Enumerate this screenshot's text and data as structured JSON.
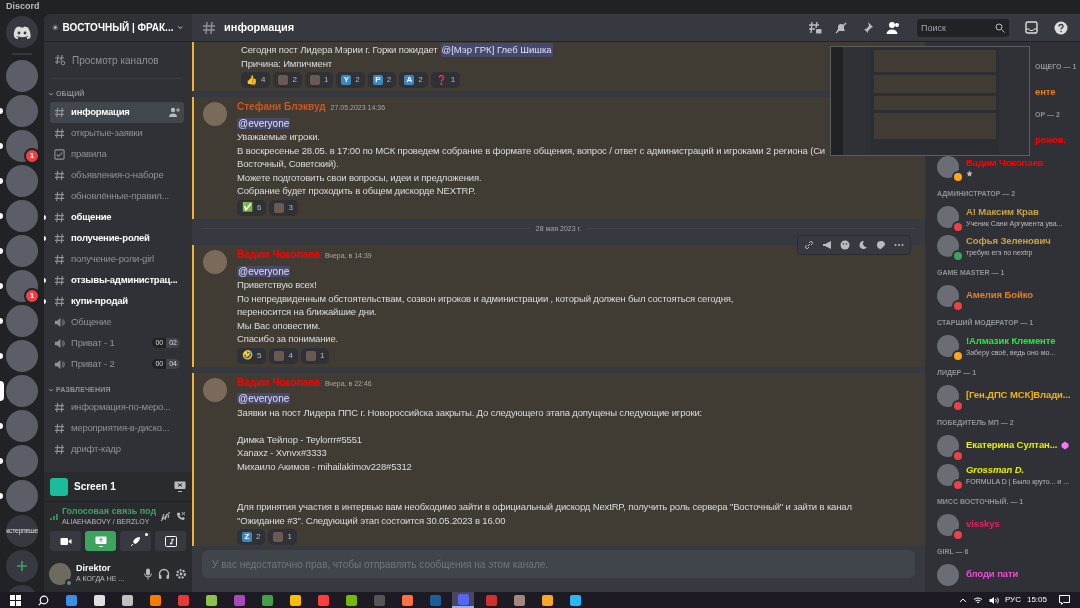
{
  "app_title": "Discord",
  "servers": [
    {
      "kind": "home",
      "unread": false,
      "selected": false
    },
    {
      "kind": "photo",
      "unread": false,
      "selected": false
    },
    {
      "kind": "photo",
      "unread": true,
      "selected": false
    },
    {
      "kind": "photo",
      "unread": true,
      "selected": false,
      "badge": "1"
    },
    {
      "kind": "photo",
      "unread": true,
      "selected": false
    },
    {
      "kind": "photo",
      "unread": true,
      "selected": false
    },
    {
      "kind": "photo",
      "unread": true,
      "selected": false
    },
    {
      "kind": "photo",
      "unread": true,
      "selected": false,
      "badge": "1"
    },
    {
      "kind": "photo",
      "unread": true,
      "selected": false
    },
    {
      "kind": "photo",
      "unread": true,
      "selected": false
    },
    {
      "kind": "photo",
      "unread": false,
      "selected": true
    },
    {
      "kind": "photo",
      "unread": true,
      "selected": false
    },
    {
      "kind": "photo",
      "unread": true,
      "selected": false
    },
    {
      "kind": "photo",
      "unread": true,
      "selected": false
    },
    {
      "kind": "text",
      "label": "кстерпеше",
      "unread": false,
      "selected": false
    },
    {
      "kind": "add",
      "unread": false,
      "selected": false
    },
    {
      "kind": "explore",
      "unread": false,
      "selected": false
    }
  ],
  "server_name": "ВОСТОЧНЫЙ | ФРАК...",
  "browse_channels": "Просмотр каналов",
  "categories": [
    {
      "label": "ОБЩИЙ",
      "channels": [
        {
          "kind": "text",
          "name": "информация",
          "selected": true,
          "unread": false
        },
        {
          "kind": "text",
          "name": "открытые-заявки",
          "selected": false,
          "unread": false
        },
        {
          "kind": "rules",
          "name": "правила",
          "selected": false,
          "unread": false
        },
        {
          "kind": "text",
          "name": "объявления-о-наборе",
          "selected": false,
          "unread": false
        },
        {
          "kind": "text",
          "name": "обновлённые-правил...",
          "selected": false,
          "unread": false
        },
        {
          "kind": "text",
          "name": "общение",
          "selected": false,
          "unread": true
        },
        {
          "kind": "text",
          "name": "получение-ролей",
          "selected": false,
          "unread": true
        },
        {
          "kind": "text",
          "name": "получение-роли-girl",
          "selected": false,
          "unread": false
        },
        {
          "kind": "text",
          "name": "отзывы-администрац...",
          "selected": false,
          "unread": true
        },
        {
          "kind": "text",
          "name": "купи-продай",
          "selected": false,
          "unread": true
        },
        {
          "kind": "voice",
          "name": "Общение",
          "selected": false,
          "unread": false
        },
        {
          "kind": "voice",
          "name": "Приват - 1",
          "selected": false,
          "unread": false,
          "users": [
            "00",
            "02"
          ]
        },
        {
          "kind": "voice",
          "name": "Приват - 2",
          "selected": false,
          "unread": false,
          "users": [
            "00",
            "04"
          ]
        }
      ]
    },
    {
      "label": "РАЗВЛЕЧЕНИЯ",
      "channels": [
        {
          "kind": "text",
          "name": "информация-по-меро...",
          "selected": false,
          "unread": false
        },
        {
          "kind": "text",
          "name": "мероприятия-в-диско...",
          "selected": false,
          "unread": false
        },
        {
          "kind": "text",
          "name": "дрифт-кадр",
          "selected": false,
          "unread": false
        }
      ]
    }
  ],
  "stream": {
    "title": "Screen 1"
  },
  "voice": {
    "status": "Голосовая связь под",
    "channel": "ALIAEHABOVY / BERZLOY",
    "buttons": [
      {
        "kind": "camera",
        "on": false
      },
      {
        "kind": "screen",
        "on": true
      },
      {
        "kind": "activity",
        "on": false
      },
      {
        "kind": "soundboard",
        "on": false
      }
    ]
  },
  "user": {
    "name": "Direktor",
    "status": "А КОГДА НЕ ..."
  },
  "channel_header": {
    "name": "информация"
  },
  "search": {
    "placeholder": "Поиск"
  },
  "messages": [
    {
      "continuation": true,
      "highlighted": true,
      "lines": [
        {
          "text": "Сегодня пост Лидера Мэрии г. Горки покидает",
          "mention": "@[Мэр ГРК] Глеб Шишка"
        },
        {
          "text": "Причина: Импичмент"
        }
      ],
      "reactions": [
        {
          "kind": "emoji",
          "emoji": "👍",
          "count": "4"
        },
        {
          "kind": "image",
          "count": "2"
        },
        {
          "kind": "image",
          "count": "1"
        },
        {
          "kind": "letter",
          "letter": "Y",
          "count": "2"
        },
        {
          "kind": "letter",
          "letter": "P",
          "count": "2"
        },
        {
          "kind": "letter",
          "letter": "A",
          "count": "2"
        },
        {
          "kind": "emoji",
          "emoji": "❓",
          "count": "1"
        }
      ]
    },
    {
      "continuation": false,
      "highlighted": true,
      "author": "Стефани Блэквуд",
      "color": "#c8562a",
      "time": "27.05.2023 14:36",
      "lines": [
        {
          "mention": "@everyone"
        },
        {
          "text": "Уважаемые игроки."
        },
        {
          "text": "В воскресенье 28.05. в 17:00  по МСК проведем собрание в формате общения, вопрос / ответ с администраций и игроками 2 региона (Си"
        },
        {
          "text": "Восточный, Советский)."
        },
        {
          "text": "Можете подготовить свои вопросы, идеи и предложения."
        },
        {
          "text": "Собрание будет проходить в общем дискорде NEXTRP."
        }
      ],
      "reactions": [
        {
          "kind": "emoji",
          "emoji": "✅",
          "count": "6"
        },
        {
          "kind": "image",
          "count": "3"
        }
      ]
    },
    {
      "divider": "28 мая 2023 г."
    },
    {
      "continuation": false,
      "highlighted": true,
      "hovered": true,
      "author": "Вадим Чокопаев",
      "color": "#ff0000",
      "time": "Вчера, в 14:39",
      "lines": [
        {
          "mention": "@everyone"
        },
        {
          "text": "Приветствую всех!"
        },
        {
          "text": "По непредвиденным обстоятельствам, созвон игроков и администрации , который должен был состояться сегодня,"
        },
        {
          "text": "переносится на ближайшие дни."
        },
        {
          "text": "Мы Вас оповестим."
        },
        {
          "text": "Спасибо за понимание."
        }
      ],
      "reactions": [
        {
          "kind": "emoji",
          "emoji": "🤣",
          "count": "5"
        },
        {
          "kind": "image",
          "count": "4"
        },
        {
          "kind": "image",
          "count": "1"
        }
      ]
    },
    {
      "continuation": false,
      "highlighted": true,
      "hovered": false,
      "author": "Вадим Чокопаев",
      "color": "#ff0000",
      "time": "Вчера, в 22:46",
      "lines": [
        {
          "mention": "@everyone"
        },
        {
          "text": "Заявки на пост Лидера ППС г. Новороссийска закрыты. До следующего этапа допущены следующие игроки:"
        },
        {
          "blank": true
        },
        {
          "text": "Димка Тейлор - Teylorrr#5551"
        },
        {
          "text": "Xanaxz - Xvnvx#3333"
        },
        {
          "text": "Михаило Акимов - mihailakimov228#5312"
        },
        {
          "blank": true
        },
        {
          "blank": true
        },
        {
          "text": "Для принятия участия в интервью вам необходимо зайти в официальный дискорд NextRP, получить роль сервера \"Восточный\" и зайти в канал"
        },
        {
          "text": "\"Ожидание #3\". Следующий этап состоится 30.05.2023 в 16.00"
        }
      ],
      "reactions": [
        {
          "kind": "letter",
          "letter": "Z",
          "count": "2"
        },
        {
          "kind": "image",
          "count": "1"
        }
      ]
    }
  ],
  "composer": {
    "placeholder": "У вас недостаточно прав, чтобы отправлять сообщения на этом канале."
  },
  "member_groups": [
    {
      "label": "ОЩЕГО — 1",
      "clipped": true,
      "members": [
        {
          "name": "енте",
          "color": "#e67e22",
          "clipped": true,
          "italic": false
        }
      ]
    },
    {
      "label": "ОР — 2",
      "clipped": true,
      "members": [
        {
          "name": "ронов.",
          "color": "#ff0000",
          "clipped": true,
          "italic": false
        },
        {
          "name": "Вадим Чокопаев",
          "color": "#ff0000",
          "status": {
            "color": "#faa81a"
          },
          "activity_icon": true,
          "clipped": false,
          "italic": false
        }
      ]
    },
    {
      "label": "АДМИНИСТРАТОР — 2",
      "clipped": false,
      "members": [
        {
          "name": "А! Максим Крав",
          "color": "#c9a443",
          "status": {
            "color": "#ed4245"
          },
          "subtitle": "Ученик Сани Аргумента ува...",
          "clipped": false,
          "italic": false
        },
        {
          "name": "Софья Зеленович",
          "color": "#c9a443",
          "status": {
            "color": "#3ba55d"
          },
          "subtitle": "требую егэ по nextrp",
          "clipped": false,
          "italic": false
        }
      ]
    },
    {
      "label": "GAME MASTER — 1",
      "clipped": false,
      "members": [
        {
          "name": "Амелия Бойко",
          "color": "#e67e22",
          "status": {
            "color": "#ed4245"
          },
          "clipped": false,
          "italic": false
        }
      ]
    },
    {
      "label": "СТАРШИЙ МОДЕРАТОР — 1",
      "clipped": false,
      "members": [
        {
          "name": "!Алмазик Клементе",
          "color": "#2ee640",
          "status": {
            "color": "#faa81a"
          },
          "subtitle": "Заберу своё, ведь оно мо...",
          "clipped": false,
          "italic": false
        }
      ]
    },
    {
      "label": "ЛИДЕР — 1",
      "clipped": false,
      "members": [
        {
          "name": "[Ген.ДПС МСК]Влади...",
          "color": "#f1b40f",
          "status": {
            "color": "#ed4245"
          },
          "clipped": false,
          "italic": false
        }
      ]
    },
    {
      "label": "ПОБЕДИТЕЛЬ МП — 2",
      "clipped": false,
      "members": [
        {
          "name": "Екатерина Султан...",
          "color": "#e5f000",
          "status": {
            "color": "#ed4245"
          },
          "booster": true,
          "clipped": false,
          "italic": false
        },
        {
          "name": "Grossman D.",
          "color": "#e5f000",
          "status": {
            "color": "#ed4245"
          },
          "subtitle": "FORMULA D | Было круто... и ...",
          "clipped": false,
          "italic": true
        }
      ]
    },
    {
      "label": "МИСС ВОСТОЧНЫЙ. — 1",
      "clipped": false,
      "members": [
        {
          "name": "visskys",
          "color": "#e91e63",
          "status": {
            "color": "#ed4245"
          },
          "clipped": false,
          "italic": false
        }
      ]
    },
    {
      "label": "GIRL — 6",
      "clipped": false,
      "members": [
        {
          "name": "блоди пати",
          "color": "#f04ad8",
          "clipped": false,
          "italic": false
        }
      ]
    }
  ],
  "taskbar": {
    "apps": [
      {
        "kind": "start",
        "selected": false
      },
      {
        "kind": "search",
        "selected": false
      },
      {
        "kind": "app",
        "color": "#3a8ee6",
        "selected": false
      },
      {
        "kind": "app",
        "color": "#e0e0e0",
        "selected": false
      },
      {
        "kind": "app",
        "color": "#c0c0c0",
        "selected": false
      },
      {
        "kind": "app",
        "color": "#f57c00",
        "selected": false
      },
      {
        "kind": "app",
        "color": "#e53935",
        "selected": false
      },
      {
        "kind": "app",
        "color": "#8bc34a",
        "selected": false
      },
      {
        "kind": "app",
        "color": "#ab47bc",
        "selected": false
      },
      {
        "kind": "app",
        "color": "#43a047",
        "selected": false
      },
      {
        "kind": "app",
        "color": "#fbbc05",
        "selected": false
      },
      {
        "kind": "app",
        "color": "#ff3d3d",
        "selected": false
      },
      {
        "kind": "app",
        "color": "#76b900",
        "selected": false
      },
      {
        "kind": "app",
        "color": "#555555",
        "selected": false
      },
      {
        "kind": "app",
        "color": "#ff7043",
        "selected": false
      },
      {
        "kind": "app",
        "color": "#1b5e9a",
        "selected": false
      },
      {
        "kind": "app",
        "color": "#5865f2",
        "selected": true
      },
      {
        "kind": "app",
        "color": "#d32f2f",
        "selected": false
      },
      {
        "kind": "app",
        "color": "#a1887f",
        "selected": false
      },
      {
        "kind": "app",
        "color": "#f9a825",
        "selected": false
      },
      {
        "kind": "app",
        "color": "#29b6f6",
        "selected": false
      }
    ],
    "language": "РУС",
    "clock": "15:05"
  }
}
